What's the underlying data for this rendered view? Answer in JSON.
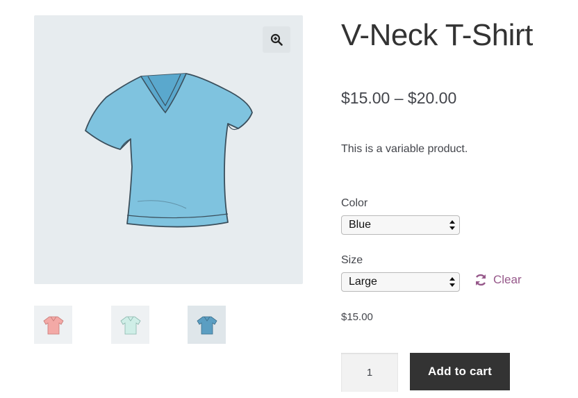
{
  "product": {
    "title": "V-Neck T-Shirt",
    "price_range": "$15.00 – $20.00",
    "description": "This is a variable product.",
    "selected_price": "$15.00"
  },
  "variations": {
    "color": {
      "label": "Color",
      "value": "Blue"
    },
    "size": {
      "label": "Size",
      "value": "Large"
    },
    "clear_label": "Clear"
  },
  "cart": {
    "quantity": "1",
    "add_to_cart_label": "Add to cart"
  },
  "gallery": {
    "thumbnails": [
      {
        "name": "pink-shirt",
        "color": "#f3a9a6"
      },
      {
        "name": "mint-shirt",
        "color": "#cfeee7"
      },
      {
        "name": "blue-shirt",
        "color": "#5b9ec2"
      }
    ],
    "main_shirt_color": "#7fc3df",
    "zoom_icon": "magnifier-plus-icon"
  },
  "colors": {
    "accent": "#96588a",
    "button_bg": "#333333",
    "gallery_bg": "#e7ecef"
  }
}
